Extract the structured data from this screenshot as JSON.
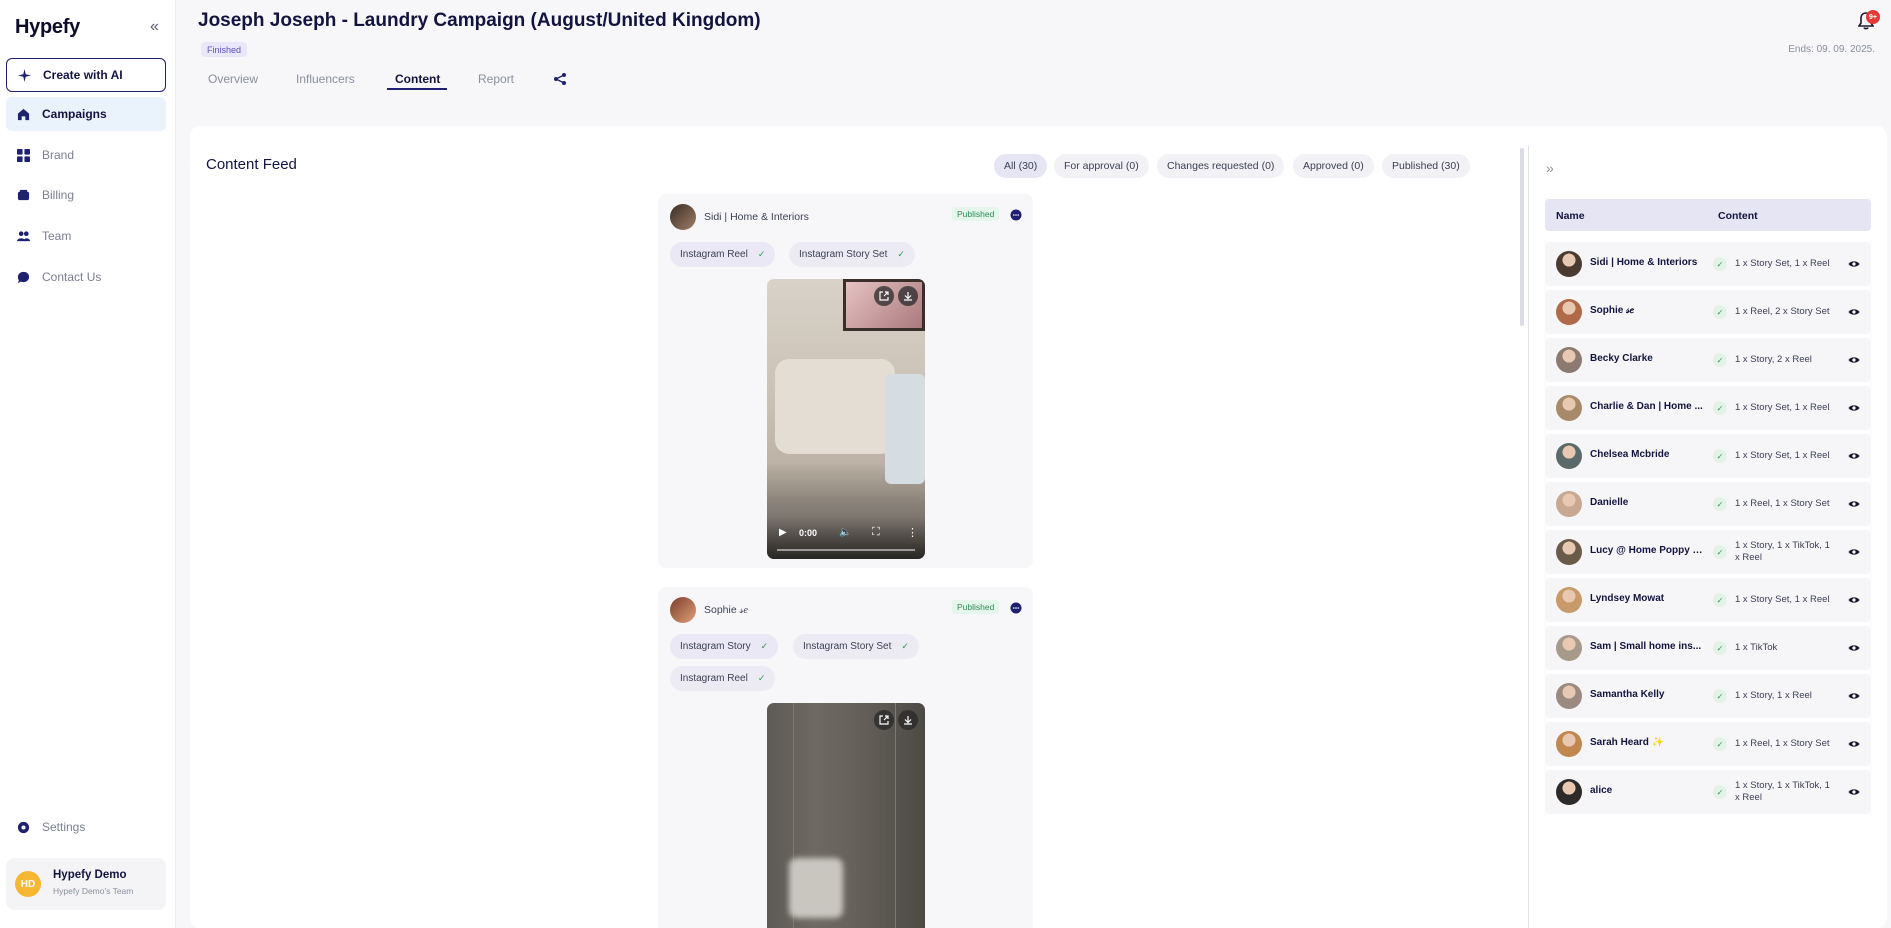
{
  "sidebar": {
    "logo": "Hypefy",
    "collapse": "«",
    "create": "Create with AI",
    "items": [
      {
        "label": "Campaigns"
      },
      {
        "label": "Brand"
      },
      {
        "label": "Billing"
      },
      {
        "label": "Team"
      },
      {
        "label": "Contact Us"
      }
    ],
    "settings": "Settings",
    "user": {
      "initials": "HD",
      "name": "Hypefy Demo",
      "team": "Hypefy Demo's Team"
    }
  },
  "header": {
    "title": "Joseph Joseph - Laundry Campaign (August/United Kingdom)",
    "status": "Finished",
    "ends": "Ends: 09. 09. 2025.",
    "notifications": "9+",
    "tabs": [
      {
        "label": "Overview"
      },
      {
        "label": "Influencers"
      },
      {
        "label": "Content"
      },
      {
        "label": "Report"
      }
    ]
  },
  "feed": {
    "title": "Content Feed",
    "filters": [
      {
        "label": "All (30)"
      },
      {
        "label": "For approval (0)"
      },
      {
        "label": "Changes requested (0)"
      },
      {
        "label": "Approved (0)"
      },
      {
        "label": "Published (30)"
      }
    ],
    "posts": [
      {
        "name": "Sidi | Home & Interiors",
        "status": "Published",
        "chips": [
          "Instagram Reel",
          "Instagram Story Set"
        ],
        "video_time": "0:00"
      },
      {
        "name": "Sophie 𝓈𝑒",
        "status": "Published",
        "chips": [
          "Instagram Story",
          "Instagram Story Set",
          "Instagram Reel"
        ]
      }
    ]
  },
  "side": {
    "expand": "»",
    "col_name": "Name",
    "col_content": "Content",
    "rows": [
      {
        "name": "Sidi | Home & Interiors",
        "content": "1 x Story Set, 1 x Reel"
      },
      {
        "name": "Sophie 𝓈𝑒",
        "content": "1 x Reel, 2 x Story Set"
      },
      {
        "name": "Becky Clarke",
        "content": "1 x Story, 2 x Reel"
      },
      {
        "name": "Charlie & Dan | Home ...",
        "content": "1 x Story Set, 1 x Reel"
      },
      {
        "name": "Chelsea Mcbride",
        "content": "1 x Story Set, 1 x Reel"
      },
      {
        "name": "Danielle",
        "content": "1 x Reel, 1 x Story Set"
      },
      {
        "name": "Lucy @ Home Poppy L...",
        "content": "1 x Story, 1 x TikTok, 1 x Reel"
      },
      {
        "name": "Lyndsey Mowat",
        "content": "1 x Story Set, 1 x Reel"
      },
      {
        "name": "Sam | Small home ins...",
        "content": "1 x TikTok"
      },
      {
        "name": "Samantha Kelly",
        "content": "1 x Story, 1 x Reel"
      },
      {
        "name": "Sarah Heard ✨",
        "content": "1 x Reel, 1 x Story Set"
      },
      {
        "name": "alice",
        "content": "1 x Story, 1 x TikTok, 1 x Reel"
      }
    ]
  }
}
